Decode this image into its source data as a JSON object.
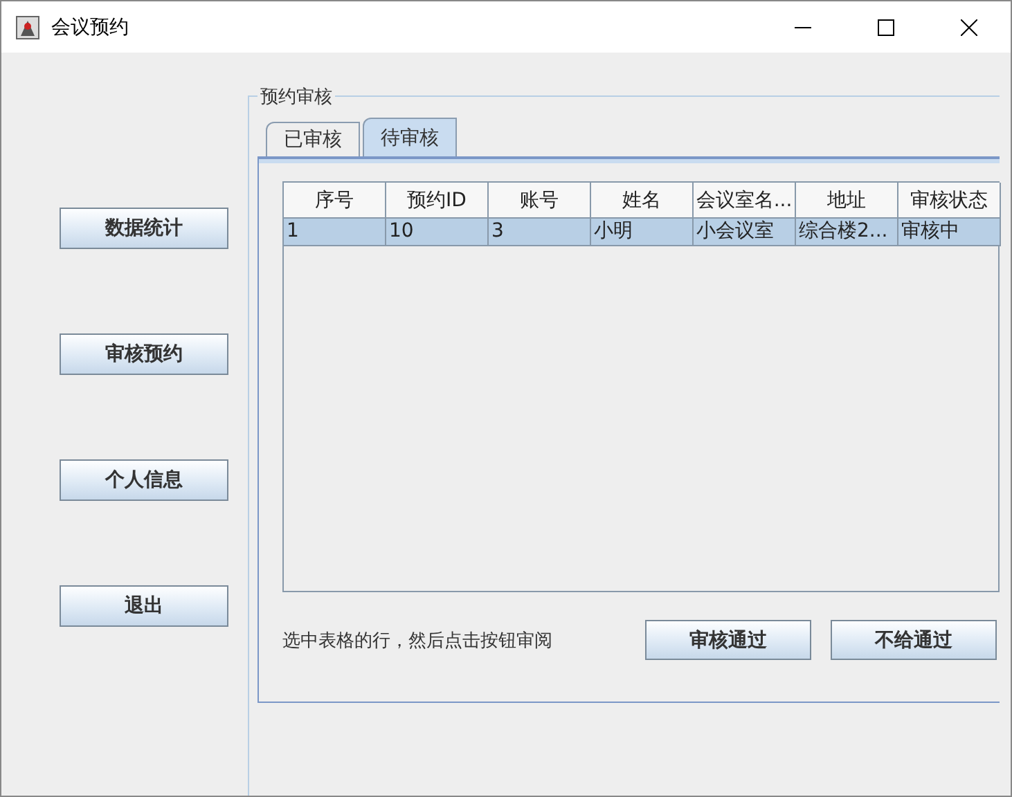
{
  "window": {
    "title": "会议预约"
  },
  "sidebar": {
    "buttons": [
      "数据统计",
      "审核预约",
      "个人信息",
      "退出"
    ]
  },
  "group": {
    "title": "预约审核"
  },
  "tabs": [
    {
      "label": "已审核",
      "selected": false
    },
    {
      "label": "待审核",
      "selected": true
    }
  ],
  "table": {
    "columns": [
      "序号",
      "预约ID",
      "账号",
      "姓名",
      "会议室名...",
      "地址",
      "审核状态"
    ],
    "rows": [
      {
        "cells": [
          "1",
          "10",
          "3",
          "小明",
          "小会议室",
          "综合楼2...",
          "审核中"
        ],
        "selected": true
      }
    ]
  },
  "hint": "选中表格的行，然后点击按钮审阅",
  "actions": [
    "审核通过",
    "不给通过"
  ]
}
